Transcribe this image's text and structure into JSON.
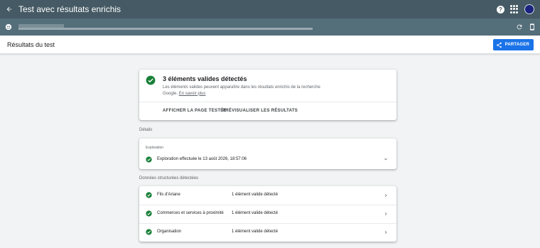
{
  "app": {
    "title": "Test avec résultats enrichis"
  },
  "toolbar": {
    "back_icon": "arrow-back-icon",
    "help_icon": "help-icon",
    "apps_icon": "apps-grid-icon",
    "account_icon": "avatar"
  },
  "url_bar": {
    "globe_icon": "globe-icon",
    "refresh_icon": "refresh-icon",
    "device_icon": "smartphone-icon"
  },
  "header": {
    "title": "Résultats du test",
    "share_label": "PARTAGER"
  },
  "summary": {
    "title": "3 éléments valides détectés",
    "description": "Les éléments valides peuvent apparaître dans les résultats enrichis de la recherche Google.",
    "learn_more": "En savoir plus",
    "action_view_page": "AFFICHER LA PAGE TESTÉE",
    "action_preview": "PRÉVISUALISER LES RÉSULTATS"
  },
  "details": {
    "section_label": "Détails",
    "crawl_heading": "Exploration",
    "crawl_text": "Exploration effectuée le 13 août 2026, 18:57:06"
  },
  "structured_data": {
    "section_label": "Données structurées détectées",
    "items": [
      {
        "name": "Fils d'Ariane",
        "status": "1 élément valide détecté"
      },
      {
        "name": "Commerces et services à proximité",
        "status": "1 élément valide détecté"
      },
      {
        "name": "Organisation",
        "status": "1 élément valide détecté"
      }
    ]
  },
  "colors": {
    "valid_green": "#188038",
    "top_bar": "#455a64",
    "url_bar": "#546e7a",
    "share_blue": "#1a73e8"
  }
}
